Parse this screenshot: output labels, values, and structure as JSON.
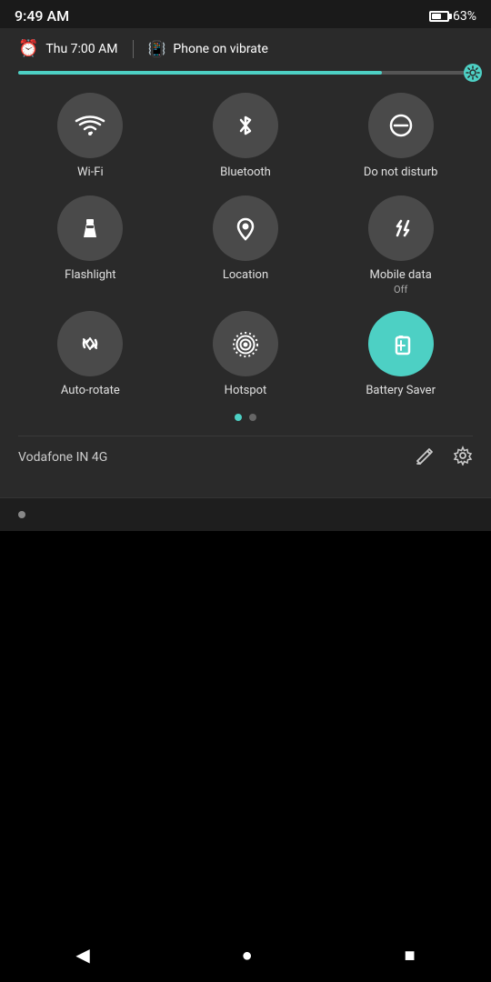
{
  "statusBar": {
    "time": "9:49 AM",
    "battery": "63%",
    "batteryPercent": 63
  },
  "alarmRow": {
    "alarmTime": "Thu 7:00 AM",
    "vibrateLabel": "Phone on vibrate"
  },
  "brightness": {
    "fillPercent": 80
  },
  "tiles": [
    {
      "id": "wifi",
      "label": "Wi-Fi",
      "active": false,
      "icon": "wifi"
    },
    {
      "id": "bluetooth",
      "label": "Bluetooth",
      "active": false,
      "icon": "bluetooth"
    },
    {
      "id": "dnd",
      "label": "Do not disturb",
      "active": false,
      "icon": "dnd"
    },
    {
      "id": "flashlight",
      "label": "Flashlight",
      "active": false,
      "icon": "flashlight"
    },
    {
      "id": "location",
      "label": "Location",
      "active": false,
      "icon": "location"
    },
    {
      "id": "mobiledata",
      "label": "Mobile data",
      "sublabel": "Off",
      "active": false,
      "icon": "mobiledata"
    },
    {
      "id": "autorotate",
      "label": "Auto-rotate",
      "active": false,
      "icon": "autorotate"
    },
    {
      "id": "hotspot",
      "label": "Hotspot",
      "active": false,
      "icon": "hotspot"
    },
    {
      "id": "batterysaver",
      "label": "Battery Saver",
      "active": true,
      "icon": "batterysaver"
    }
  ],
  "footer": {
    "carrier": "Vodafone IN 4G",
    "editLabel": "edit",
    "settingsLabel": "settings"
  },
  "navBar": {
    "back": "◀",
    "home": "●",
    "recents": "■"
  }
}
